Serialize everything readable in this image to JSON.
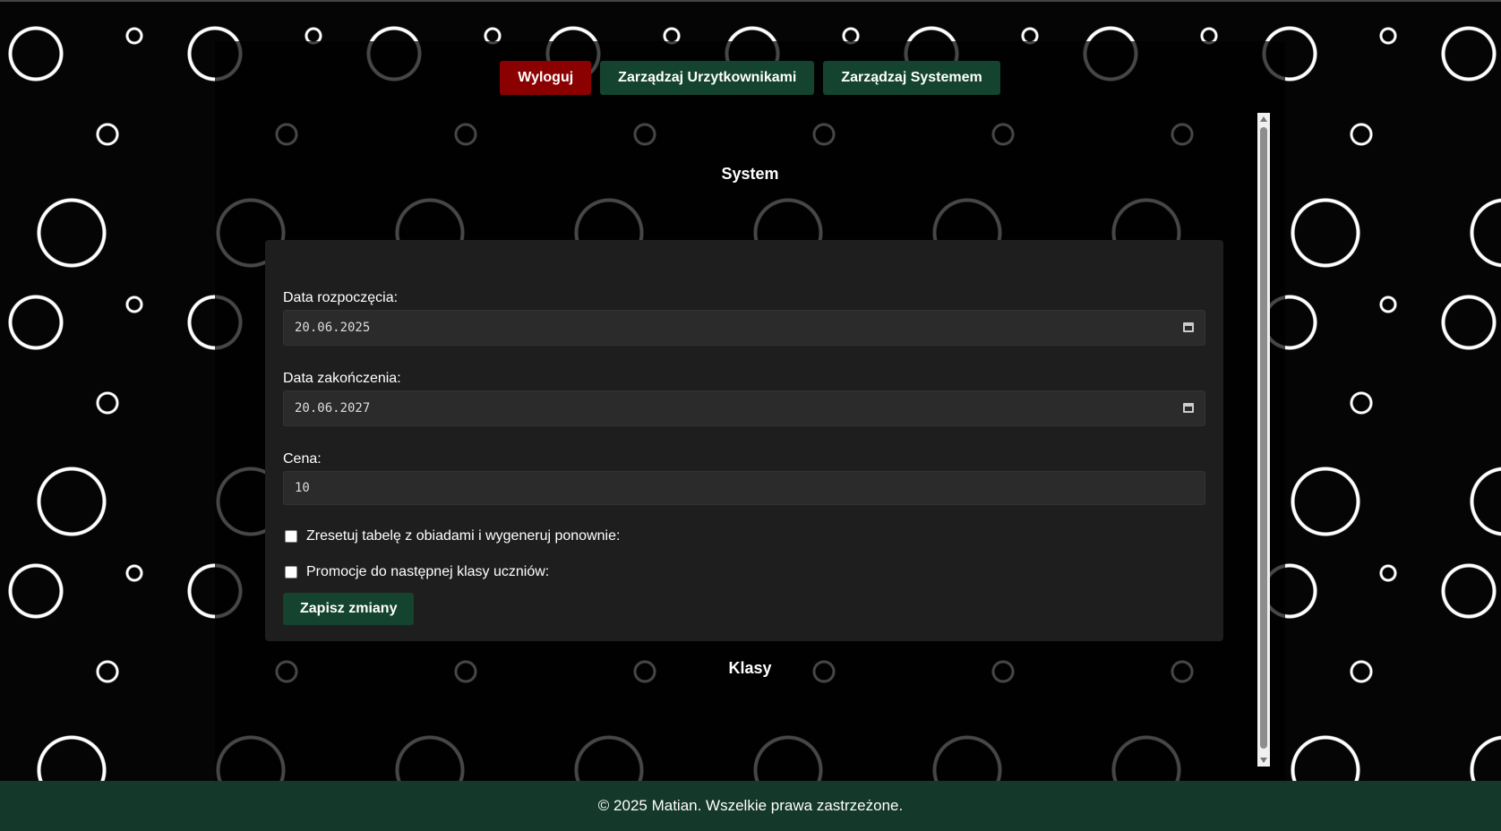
{
  "nav": {
    "logout": "Wyloguj",
    "manage_users": "Zarządzaj Urzytkownikami",
    "manage_system": "Zarządzaj Systemem"
  },
  "system": {
    "title": "System",
    "start_date_label": "Data rozpoczęcia:",
    "start_date_value": "20.06.2025",
    "end_date_label": "Data zakończenia:",
    "end_date_value": "20.06.2027",
    "price_label": "Cena:",
    "price_value": "10",
    "reset_label": "Zresetuj tabelę z obiadami i wygeneruj ponownie:",
    "promote_label": "Promocje do następnej klasy uczniów:",
    "save_label": "Zapisz zmiany"
  },
  "classes": {
    "title": "Klasy"
  },
  "footer": {
    "text": "© 2025 Matian. Wszelkie prawa zastrzeżone."
  },
  "colors": {
    "logout_bg": "#8b0000",
    "accent_green": "#14432f",
    "footer_bg": "#14382a"
  }
}
